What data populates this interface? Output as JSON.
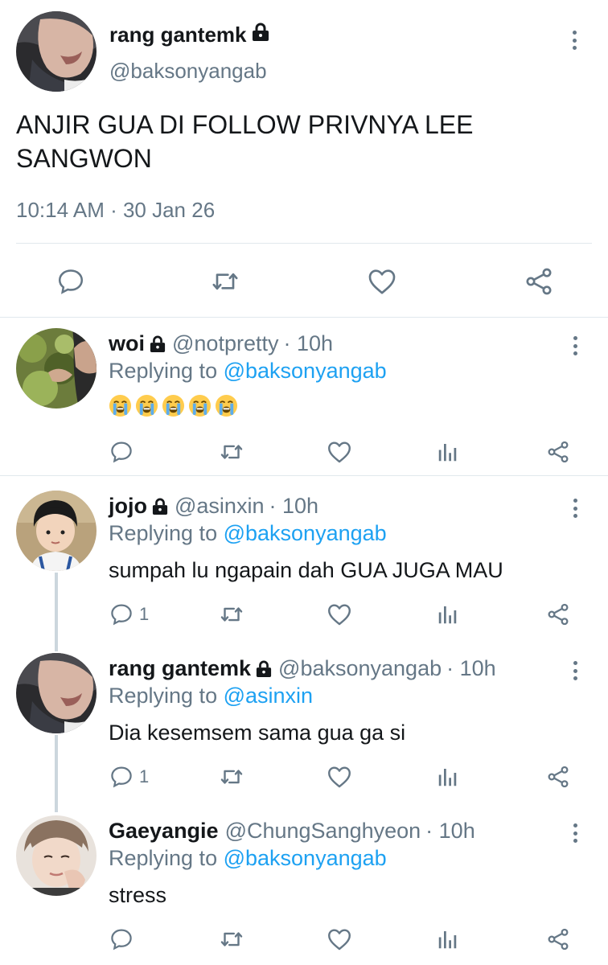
{
  "main_tweet": {
    "name": "rang gantemk",
    "handle": "@baksonyangab",
    "text": "ANJIR GUA DI FOLLOW PRIVNYA LEE SANGWON",
    "timestamp": "10:14 AM · 30 Jan 26",
    "actions": [
      "reply-icon",
      "retweet-icon",
      "like-icon",
      "share-icon"
    ]
  },
  "replies": [
    {
      "name": "woi",
      "handle": "@notpretty",
      "time": "· 10h",
      "replying_prefix": "Replying to ",
      "replying_to": "@baksonyangab",
      "text": "",
      "emoji_icon": "loudly-crying-face-icon",
      "emoji_count": 5,
      "reply_count": ""
    },
    {
      "name": "jojo",
      "handle": "@asinxin",
      "time": "· 10h",
      "replying_prefix": "Replying to ",
      "replying_to": "@baksonyangab",
      "text": "sumpah lu ngapain dah GUA JUGA MAU",
      "reply_count": "1"
    },
    {
      "name": "rang gantemk",
      "handle": "@baksonyangab",
      "time": "· 10h",
      "replying_prefix": "Replying to ",
      "replying_to": "@asinxin",
      "text": "Dia kesemsem sama gua ga si",
      "reply_count": "1"
    },
    {
      "name": "Gaeyangie",
      "handle": "@ChungSanghyeon",
      "time": "· 10h",
      "replying_prefix": "Replying to ",
      "replying_to": "@baksonyangab",
      "text": "stress",
      "reply_count": ""
    }
  ],
  "colors": {
    "text": "#14171a",
    "secondary": "#657786",
    "link": "#1da1f2",
    "divider": "#e1e8ed",
    "thread_line": "#ccd6dd"
  }
}
